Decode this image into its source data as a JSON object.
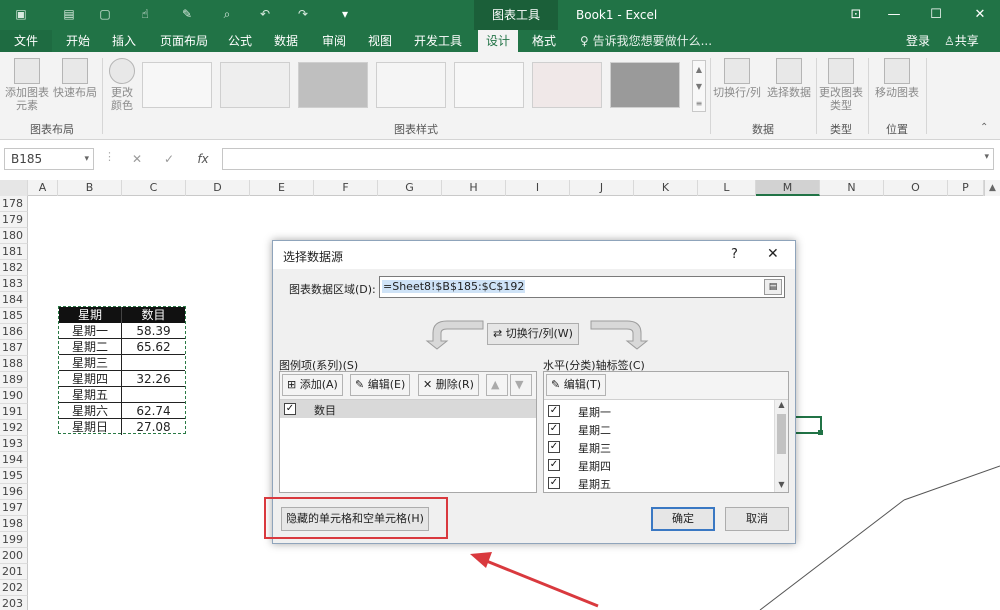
{
  "app": {
    "window_title": "Book1 - Excel",
    "context_tools": "图表工具",
    "tellme": "告诉我您想要做什么...",
    "login": "登录",
    "share": "共享"
  },
  "tabs": [
    {
      "label": "文件"
    },
    {
      "label": "开始"
    },
    {
      "label": "插入"
    },
    {
      "label": "页面布局"
    },
    {
      "label": "公式"
    },
    {
      "label": "数据"
    },
    {
      "label": "审阅"
    },
    {
      "label": "视图"
    },
    {
      "label": "开发工具"
    },
    {
      "label": "设计"
    },
    {
      "label": "格式"
    }
  ],
  "ribbon": {
    "add_element": "添加图表元素",
    "quick_layout": "快速布局",
    "change_colors": "更改颜色",
    "group_layout": "图表布局",
    "group_styles": "图表样式",
    "switch_rowcol": "切换行/列",
    "select_data": "选择数据",
    "group_data": "数据",
    "change_type": "更改图表类型",
    "group_type": "类型",
    "move_chart": "移动图表",
    "group_location": "位置"
  },
  "formula_bar": {
    "name_box": "B185",
    "fx": "fx",
    "content": ""
  },
  "columns": [
    "A",
    "B",
    "C",
    "D",
    "E",
    "F",
    "G",
    "H",
    "I",
    "J",
    "K",
    "L",
    "M",
    "N",
    "O",
    "P"
  ],
  "rows": [
    "178",
    "179",
    "180",
    "181",
    "182",
    "183",
    "184",
    "185",
    "186",
    "187",
    "188",
    "189",
    "190",
    "191",
    "192",
    "193",
    "194",
    "195",
    "196",
    "197",
    "198",
    "199",
    "200",
    "201",
    "202",
    "203"
  ],
  "table": {
    "header": [
      "星期",
      "数目"
    ],
    "rows": [
      [
        "星期一",
        "58.39"
      ],
      [
        "星期二",
        "65.62"
      ],
      [
        "星期三",
        ""
      ],
      [
        "星期四",
        "32.26"
      ],
      [
        "星期五",
        ""
      ],
      [
        "星期六",
        "62.74"
      ],
      [
        "星期日",
        "27.08"
      ]
    ]
  },
  "dialog": {
    "title": "选择数据源",
    "help": "?",
    "close": "✕",
    "range_label": "图表数据区域(D):",
    "range_value": "=Sheet8!$B$185:$C$192",
    "switch_button": "切换行/列(W)",
    "legend_label": "图例项(系列)(S)",
    "add": "添加(A)",
    "edit": "编辑(E)",
    "delete": "删除(R)",
    "series": [
      {
        "name": "数目",
        "checked": true
      }
    ],
    "axis_label": "水平(分类)轴标签(C)",
    "axis_edit": "编辑(T)",
    "categories": [
      {
        "name": "星期一",
        "checked": true
      },
      {
        "name": "星期二",
        "checked": true
      },
      {
        "name": "星期三",
        "checked": true
      },
      {
        "name": "星期四",
        "checked": true
      },
      {
        "name": "星期五",
        "checked": true
      }
    ],
    "hidden_cells": "隐藏的单元格和空单元格(H)",
    "ok": "确定",
    "cancel": "取消"
  },
  "colors": {
    "excel_green": "#217346",
    "highlight_red": "#d9393e",
    "focus_blue": "#3a78c3"
  }
}
